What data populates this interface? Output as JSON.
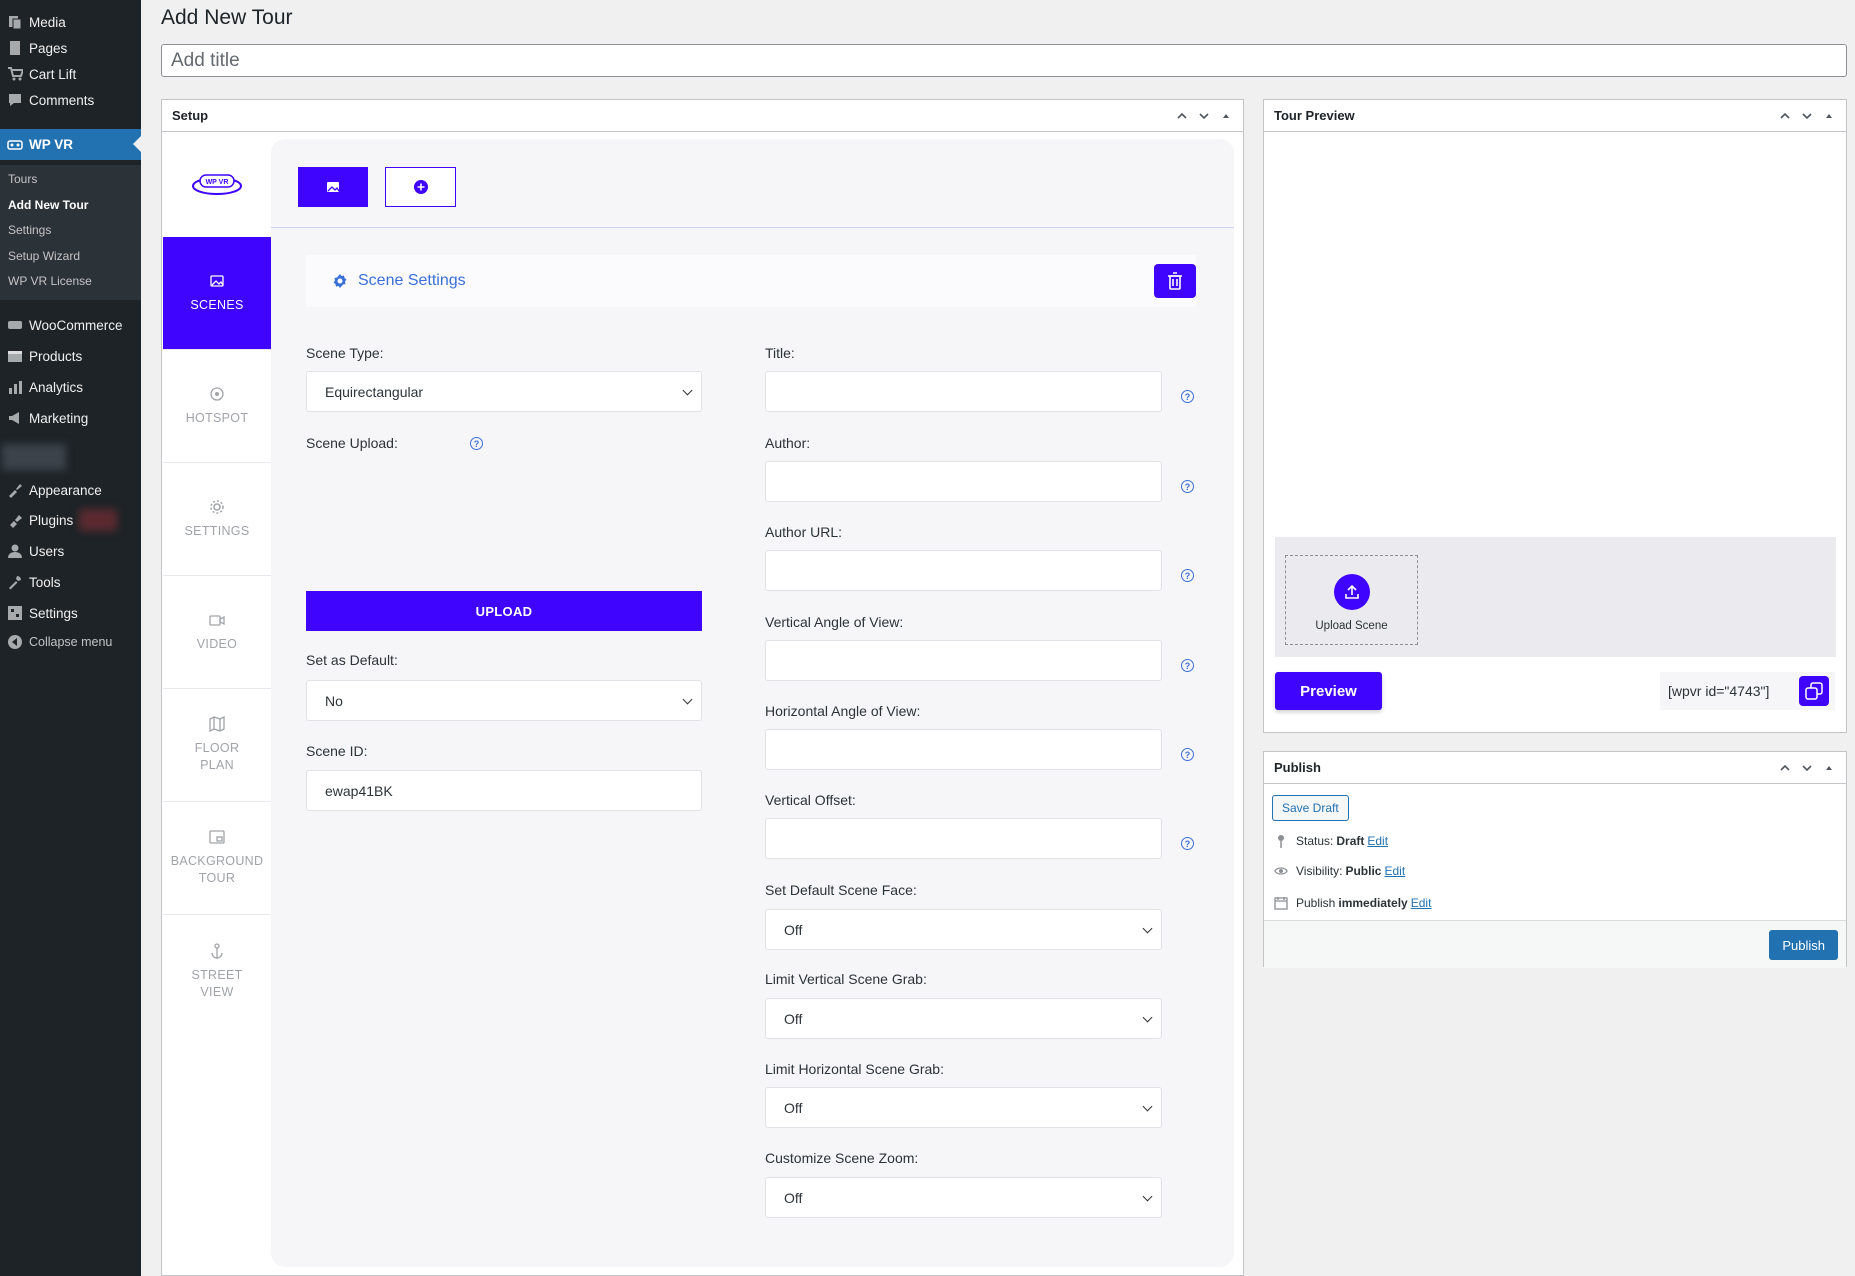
{
  "admin_menu": {
    "items": [
      {
        "label": "Media",
        "icon": "media-icon"
      },
      {
        "label": "Pages",
        "icon": "pages-icon"
      },
      {
        "label": "Cart Lift",
        "icon": "cart-icon"
      },
      {
        "label": "Comments",
        "icon": "comments-icon"
      },
      {
        "label": "WP VR",
        "icon": "vr-icon"
      },
      {
        "label": "WooCommerce",
        "icon": "woo-icon"
      },
      {
        "label": "Products",
        "icon": "products-icon"
      },
      {
        "label": "Analytics",
        "icon": "analytics-icon"
      },
      {
        "label": "Marketing",
        "icon": "marketing-icon"
      },
      {
        "label": "Appearance",
        "icon": "appearance-icon"
      },
      {
        "label": "Plugins",
        "icon": "plugins-icon"
      },
      {
        "label": "Users",
        "icon": "users-icon"
      },
      {
        "label": "Tools",
        "icon": "tools-icon"
      },
      {
        "label": "Settings",
        "icon": "settings-icon"
      },
      {
        "label": "Collapse menu",
        "icon": "collapse-icon"
      }
    ],
    "submenu": [
      "Tours",
      "Add New Tour",
      "Settings",
      "Setup Wizard",
      "WP VR License"
    ]
  },
  "page": {
    "title": "Add New Tour",
    "title_placeholder": "Add title"
  },
  "setup": {
    "header": "Setup",
    "logo_text": "WP VR",
    "tabs": [
      {
        "label": "SCENES"
      },
      {
        "label": "HOTSPOT"
      },
      {
        "label": "SETTINGS"
      },
      {
        "label": "VIDEO"
      },
      {
        "label": "FLOOR PLAN"
      },
      {
        "label": "BACKGROUND TOUR"
      },
      {
        "label": "STREET VIEW"
      }
    ],
    "scene_settings_label": "Scene Settings",
    "left_fields": {
      "scene_type_label": "Scene Type:",
      "scene_type_value": "Equirectangular",
      "scene_upload_label": "Scene Upload:",
      "upload_button": "UPLOAD",
      "set_default_label": "Set as Default:",
      "set_default_value": "No",
      "scene_id_label": "Scene ID:",
      "scene_id_value": "ewap41BK"
    },
    "right_fields": {
      "title_label": "Title:",
      "author_label": "Author:",
      "author_url_label": "Author URL:",
      "vaov_label": "Vertical Angle of View:",
      "haov_label": "Horizontal Angle of View:",
      "voffset_label": "Vertical Offset:",
      "face_label": "Set Default Scene Face:",
      "face_value": "Off",
      "vgrab_label": "Limit Vertical Scene Grab:",
      "vgrab_value": "Off",
      "hgrab_label": "Limit Horizontal Scene Grab:",
      "hgrab_value": "Off",
      "zoom_label": "Customize Scene Zoom:",
      "zoom_value": "Off"
    }
  },
  "tour_preview": {
    "header": "Tour Preview",
    "upload_scene_label": "Upload Scene",
    "preview_button": "Preview",
    "shortcode": "[wpvr id=\"4743\"]"
  },
  "publish": {
    "header": "Publish",
    "save_draft": "Save Draft",
    "status_label": "Status:",
    "status_value": "Draft",
    "visibility_label": "Visibility:",
    "visibility_value": "Public",
    "publish_label": "Publish",
    "publish_value": "immediately",
    "edit_link": "Edit",
    "publish_button": "Publish"
  }
}
